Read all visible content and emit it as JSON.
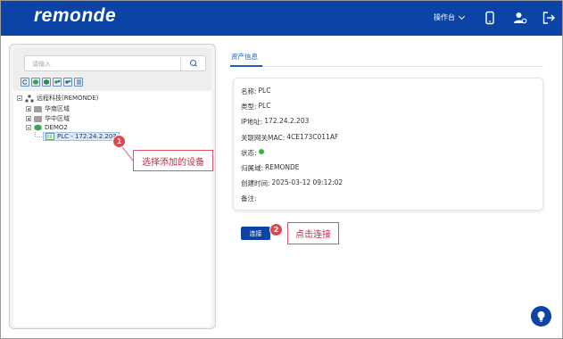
{
  "header": {
    "logo": "remonde",
    "workbench": "操作台",
    "bg_color": "#0b43a7",
    "icons": [
      "mobile-icon",
      "user-settings-icon",
      "logout-icon"
    ]
  },
  "left": {
    "search": {
      "placeholder": "请输入"
    },
    "toolbar_icons": [
      "refresh-icon",
      "cube-icon",
      "cube-alt-icon",
      "gears-icon",
      "gears-alt-icon",
      "list-icon"
    ],
    "tree": {
      "root": "远程科技(REMONDE)",
      "items": [
        {
          "label": "华南区域"
        },
        {
          "label": "华中区域"
        },
        {
          "label": "DEMO2"
        }
      ],
      "device": "PLC - 172.24.2.203"
    }
  },
  "tab": {
    "label": "资产信息"
  },
  "asset": {
    "rows": [
      {
        "label": "名称:",
        "value": "PLC"
      },
      {
        "label": "类型:",
        "value": "PLC"
      },
      {
        "label": "IP地址:",
        "value": "172.24.2.203"
      },
      {
        "label": "关联网关MAC:",
        "value": "4CE173C011AF"
      },
      {
        "label": "状态:",
        "value": ""
      },
      {
        "label": "归属域:",
        "value": "REMONDE"
      },
      {
        "label": "创建时间:",
        "value": "2025-03-12 09:12:02"
      },
      {
        "label": "备注:",
        "value": ""
      }
    ],
    "status_color": "#34b34a"
  },
  "connect": {
    "label": "连接"
  },
  "annotations": [
    {
      "num": "1",
      "text": "选择添加的设备"
    },
    {
      "num": "2",
      "text": "点击连接"
    }
  ]
}
